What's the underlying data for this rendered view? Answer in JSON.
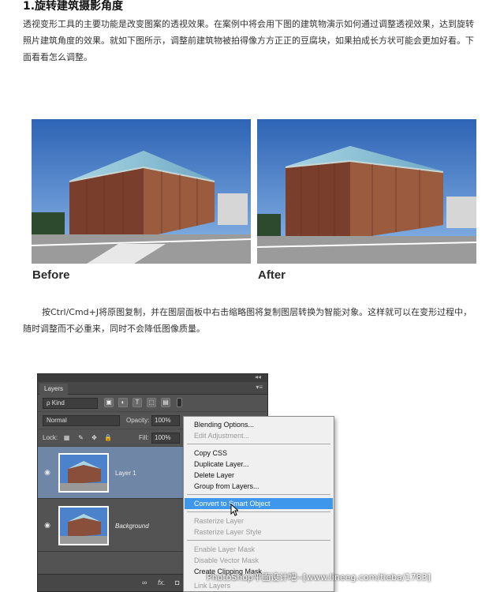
{
  "article": {
    "heading": "1.旋转建筑摄影角度",
    "intro": "透视变形工具的主要功能是改变图案的透视效果。在案例中将会用下图的建筑物演示如何通过调整透视效果，达到旋转照片建筑角度的效果。就如下图所示，调整前建筑物被拍得像方方正正的豆腐块，如果拍成长方状可能会更加好看。下面看看怎么调整。",
    "caption_before": "Before",
    "caption_after": "After",
    "instruction": "按Ctrl/Cmd+J将原图复制，并在图层面板中右击缩略图将复制图层转换为智能对象。这样就可以在变形过程中，随时调整而不必重来，同时不会降低图像质量。"
  },
  "layers_panel": {
    "collapse_glyph": "◂◂",
    "tab": "Layers",
    "menu_glyph": "▾≡",
    "kind": "ρ Kind",
    "blend_mode": "Normal",
    "opacity_label": "Opacity:",
    "opacity_value": "100%",
    "lock_label": "Lock:",
    "fill_label": "Fill:",
    "fill_value": "100%",
    "layers": [
      {
        "name": "Layer 1",
        "selected": true
      },
      {
        "name": "Background",
        "selected": false
      }
    ],
    "footer_link": "∞",
    "footer_fx": "fx."
  },
  "context_menu": {
    "items": [
      {
        "label": "Blending Options...",
        "enabled": true
      },
      {
        "label": "Edit Adjustment...",
        "enabled": false
      },
      {
        "label": "Copy CSS",
        "enabled": true
      },
      {
        "label": "Duplicate Layer...",
        "enabled": true
      },
      {
        "label": "Delete Layer",
        "enabled": true
      },
      {
        "label": "Group from Layers...",
        "enabled": true
      },
      {
        "label": "Convert to Smart Object",
        "enabled": true,
        "highlighted": true
      },
      {
        "label": "Rasterize Layer",
        "enabled": false
      },
      {
        "label": "Rasterize Layer Style",
        "enabled": false
      },
      {
        "label": "Enable Layer Mask",
        "enabled": false
      },
      {
        "label": "Disable Vector Mask",
        "enabled": false
      },
      {
        "label": "Create Clipping Mask",
        "enabled": true
      },
      {
        "label": "Link Layers",
        "enabled": false
      }
    ]
  },
  "watermark": "PhotoShop平面设计吧--[www.lineeg.com/tieba/1783]",
  "colors": {
    "panel_bg": "#535353",
    "selected_layer": "#6f86a6",
    "menu_highlight": "#3e97ea",
    "sky": "#3f79c6",
    "building": "#8a4f3a"
  }
}
